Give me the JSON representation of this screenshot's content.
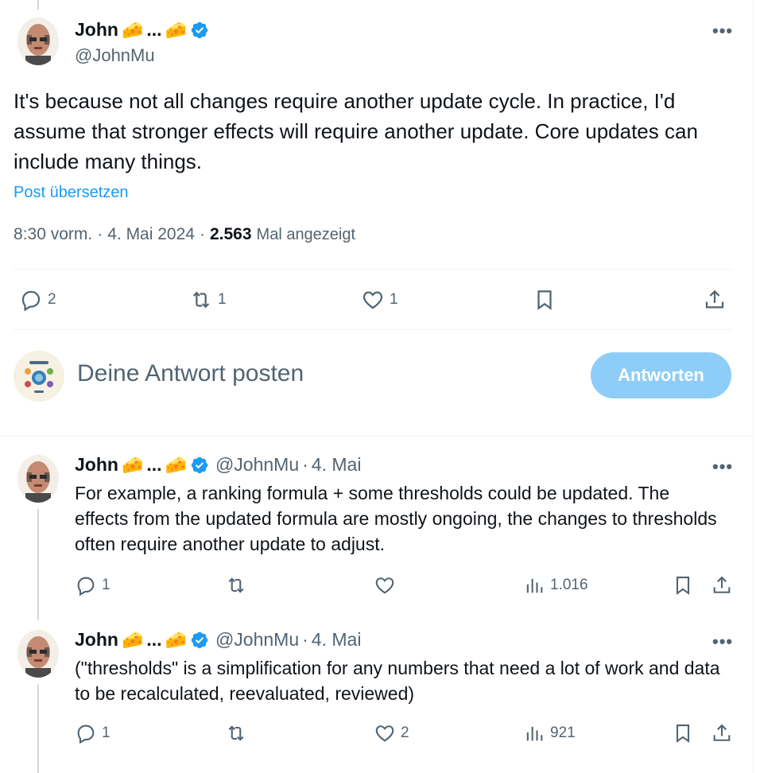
{
  "main_post": {
    "author_name": "John",
    "name_suffix": "...",
    "handle": "@JohnMu",
    "text": "It's because not all changes require another update cycle. In practice, I'd assume that stronger effects will require another update. Core updates can include many things.",
    "translate_label": "Post übersetzen",
    "time": "8:30 vorm.",
    "date": "4. Mai 2024",
    "views_count": "2.563",
    "views_label": "Mal angezeigt",
    "replies": "2",
    "reposts": "1",
    "likes": "1"
  },
  "composer": {
    "placeholder": "Deine Antwort posten",
    "button_label": "Antworten"
  },
  "replies": [
    {
      "author_name": "John",
      "name_suffix": "...",
      "handle": "@JohnMu",
      "date": "4. Mai",
      "text": "For example, a ranking formula + some thresholds could be updated. The effects from the updated formula are mostly ongoing, the changes to thresholds often require another update to adjust.",
      "replies": "1",
      "reposts": "",
      "likes": "",
      "views": "1.016"
    },
    {
      "author_name": "John",
      "name_suffix": "...",
      "handle": "@JohnMu",
      "date": "4. Mai",
      "text": "(\"thresholds\" is a simplification for any numbers that need a lot of work and data to be recalculated, reevaluated, reviewed)",
      "replies": "1",
      "reposts": "",
      "likes": "2",
      "views": "921"
    }
  ],
  "colors": {
    "accent": "#1d9bf0",
    "button_disabled": "#8ecdf8",
    "secondary_text": "#536471"
  }
}
